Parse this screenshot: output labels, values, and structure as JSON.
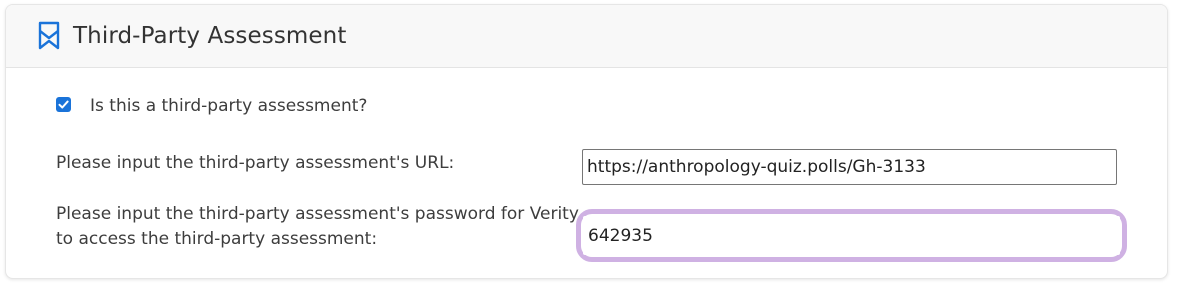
{
  "section": {
    "title": "Third-Party Assessment",
    "icon": "bookmark-icon",
    "accent_color": "#1a73d9"
  },
  "third_party_checkbox": {
    "checked": true,
    "label": "Is this a third-party assessment?"
  },
  "url_field": {
    "label": "Please input the third-party assessment's URL:",
    "value": "https://anthropology-quiz.polls/Gh-3133"
  },
  "password_field": {
    "label": "Please input the third-party assessment's password for Verity to access the third-party assessment:",
    "value": "642935",
    "focus_ring_color": "#cfb1e3"
  }
}
